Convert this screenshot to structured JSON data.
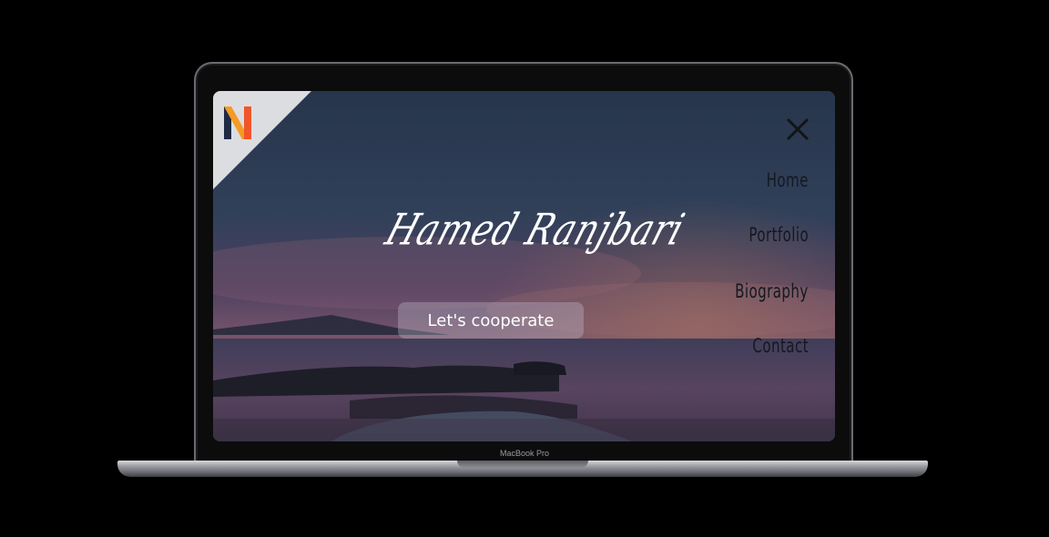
{
  "device": {
    "model_label": "MacBook Pro"
  },
  "site": {
    "signature": "Hamed Ranjbari",
    "cta_label": "Let's cooperate",
    "nav": [
      {
        "label": "Home"
      },
      {
        "label": "Portfolio"
      },
      {
        "label": "Biography"
      },
      {
        "label": "Contact"
      }
    ],
    "icons": {
      "logo": "n-logo-icon",
      "close": "close-icon"
    }
  },
  "colors": {
    "nav_text": "#141820",
    "cta_bg": "rgba(200,200,215,0.32)",
    "logo_orange": "#f5a623",
    "logo_dark": "#1e2a44"
  }
}
